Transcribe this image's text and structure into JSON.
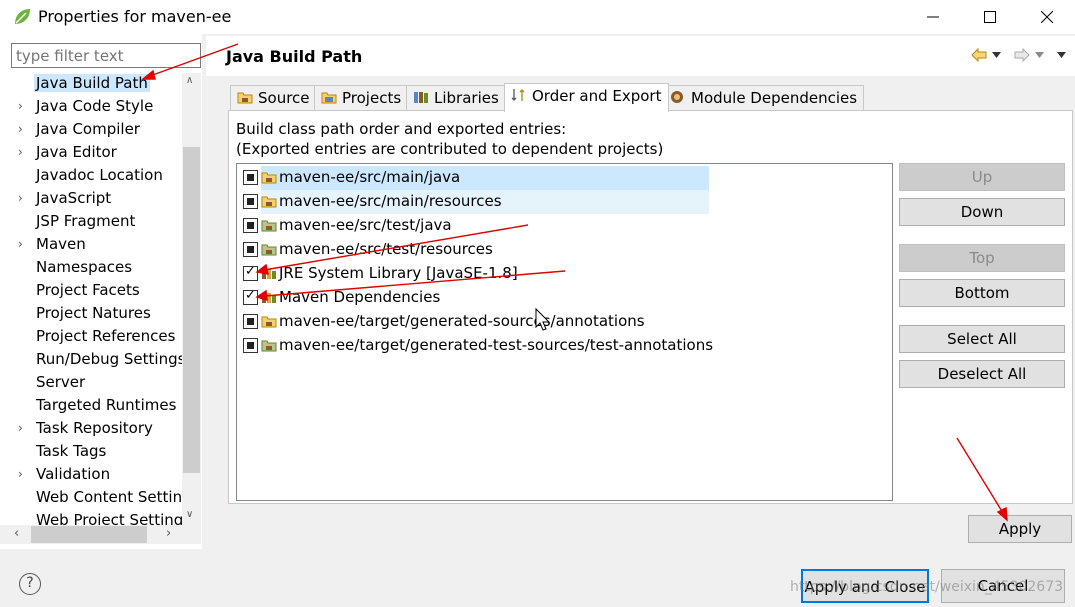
{
  "window": {
    "title": "Properties for maven-ee",
    "controls": {
      "minimize": "—",
      "maximize": "☐",
      "close": "✕"
    }
  },
  "filter": {
    "placeholder": "type filter text"
  },
  "tree": {
    "items": [
      {
        "label": "Java Build Path",
        "expandable": false,
        "selected": true
      },
      {
        "label": "Java Code Style",
        "expandable": true
      },
      {
        "label": "Java Compiler",
        "expandable": true
      },
      {
        "label": "Java Editor",
        "expandable": true
      },
      {
        "label": "Javadoc Location",
        "expandable": false
      },
      {
        "label": "JavaScript",
        "expandable": true
      },
      {
        "label": "JSP Fragment",
        "expandable": false
      },
      {
        "label": "Maven",
        "expandable": true
      },
      {
        "label": "Namespaces",
        "expandable": false
      },
      {
        "label": "Project Facets",
        "expandable": false
      },
      {
        "label": "Project Natures",
        "expandable": false
      },
      {
        "label": "Project References",
        "expandable": false
      },
      {
        "label": "Run/Debug Settings",
        "expandable": false
      },
      {
        "label": "Server",
        "expandable": false
      },
      {
        "label": "Targeted Runtimes",
        "expandable": false
      },
      {
        "label": "Task Repository",
        "expandable": true
      },
      {
        "label": "Task Tags",
        "expandable": false
      },
      {
        "label": "Validation",
        "expandable": true
      },
      {
        "label": "Web Content Settin",
        "expandable": false
      },
      {
        "label": "Web Project Setting",
        "expandable": false
      }
    ]
  },
  "page": {
    "title": "Java Build Path"
  },
  "tabs": [
    {
      "label": "Source",
      "icon": "source-folder-icon"
    },
    {
      "label": "Projects",
      "icon": "projects-icon"
    },
    {
      "label": "Libraries",
      "icon": "libraries-icon"
    },
    {
      "label": "Order and Export",
      "icon": "order-export-icon",
      "active": true
    },
    {
      "label": "Module Dependencies",
      "icon": "module-icon"
    }
  ],
  "description": {
    "line1": "Build class path order and exported entries:",
    "line2": "(Exported entries are contributed to dependent projects)"
  },
  "entries": [
    {
      "label": "maven-ee/src/main/java",
      "state": "mixed",
      "icon": "source-folder-icon",
      "highlight": true
    },
    {
      "label": "maven-ee/src/main/resources",
      "state": "mixed",
      "icon": "source-folder-icon",
      "highlight": true
    },
    {
      "label": "maven-ee/src/test/java",
      "state": "mixed",
      "icon": "test-folder-icon"
    },
    {
      "label": "maven-ee/src/test/resources",
      "state": "mixed",
      "icon": "test-folder-icon"
    },
    {
      "label": "JRE System Library [JavaSE-1.8]",
      "state": "checked",
      "icon": "library-icon"
    },
    {
      "label": "Maven Dependencies",
      "state": "checked",
      "icon": "library-icon"
    },
    {
      "label": "maven-ee/target/generated-sources/annotations",
      "state": "mixed",
      "icon": "source-folder-icon"
    },
    {
      "label": "maven-ee/target/generated-test-sources/test-annotations",
      "state": "mixed",
      "icon": "test-folder-icon"
    }
  ],
  "buttons": {
    "up": "Up",
    "down": "Down",
    "top": "Top",
    "bottom": "Bottom",
    "select_all": "Select All",
    "deselect_all": "Deselect All",
    "apply": "Apply"
  },
  "footer": {
    "help": "?",
    "apply_close": "Apply and Close",
    "cancel": "Cancel",
    "watermark": "https://blog.csdn.net/weixin_45302673"
  },
  "colors": {
    "selection": "#cce8ff",
    "annotation_arrow": "#e00000",
    "default_button_border": "#0078d7"
  }
}
